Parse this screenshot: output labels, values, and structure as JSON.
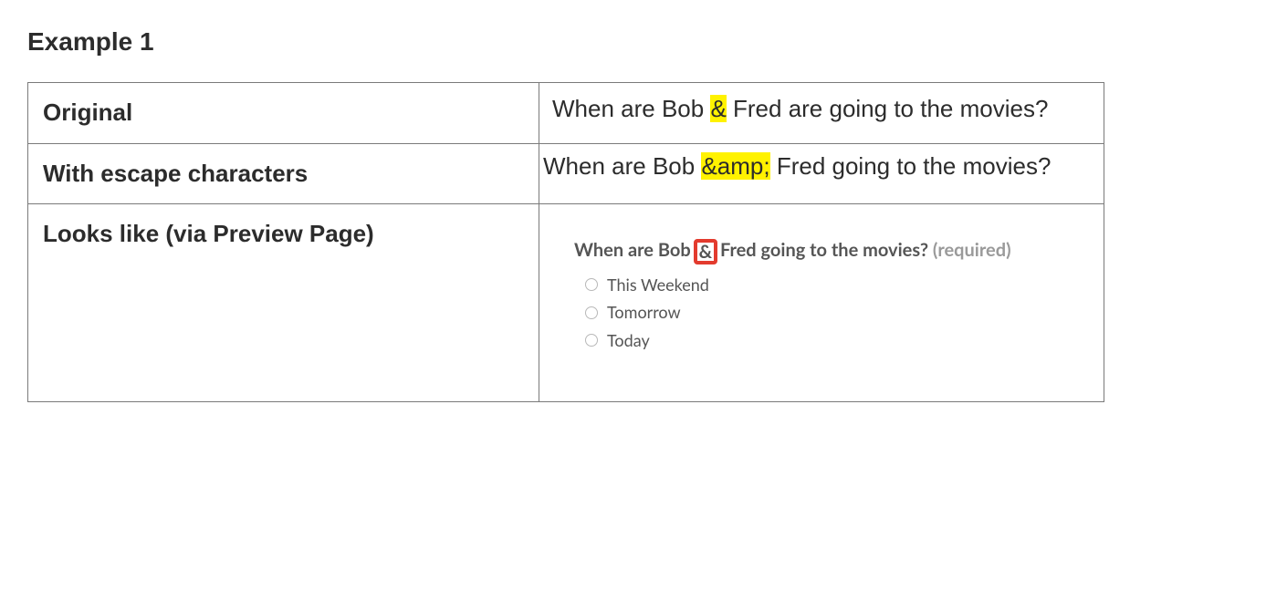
{
  "title": "Example 1",
  "rows": {
    "original": {
      "label": "Original",
      "text_before": "When are Bob ",
      "highlight": "&",
      "text_after": " Fred are going to the movies?"
    },
    "escaped": {
      "label": "With escape characters",
      "text_before": "When are Bob ",
      "highlight": "&amp;",
      "text_after": " Fred going to the movies?"
    },
    "preview": {
      "label": "Looks like (via Preview Page)",
      "question_before": "When are Bob",
      "callout": "&",
      "question_after": "Fred going to the movies?",
      "required": "(required)",
      "options": [
        "This Weekend",
        "Tomorrow",
        "Today"
      ]
    }
  }
}
